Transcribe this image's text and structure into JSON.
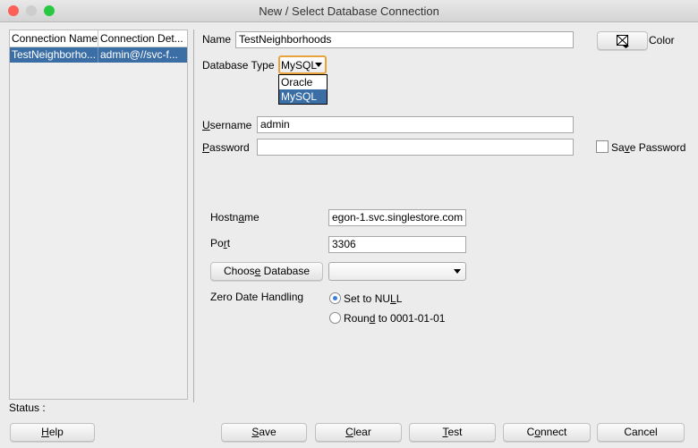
{
  "window": {
    "title": "New / Select Database Connection"
  },
  "connections": {
    "headers": [
      "Connection Name",
      "Connection Det..."
    ],
    "rows": [
      {
        "name": "TestNeighborho...",
        "details": "admin@//svc-f..."
      }
    ]
  },
  "form": {
    "name_label": "Name",
    "name_value": "TestNeighborhoods",
    "color_label": "Color",
    "dbtype_label": "Database Type",
    "dbtype_value": "MySQL",
    "dbtype_options": [
      "Oracle",
      "MySQL"
    ],
    "username_label": "Username",
    "username_mn": 0,
    "username_value": "admin",
    "password_label": "Password",
    "password_mn": 0,
    "password_value": "",
    "save_password_label": "Save Password",
    "save_password_mn": 2,
    "save_password_checked": false,
    "hostname_label": "Hostname",
    "hostname_mn": 5,
    "hostname_value": "egon-1.svc.singlestore.com",
    "port_label": "Port",
    "port_mn": 2,
    "port_value": "3306",
    "choose_db_label": "Choose Database",
    "choose_db_mn": 5,
    "database_value": "",
    "zero_date_label": "Zero Date Handling",
    "zero_date_options": [
      {
        "label": "Set to NULL",
        "mn": 9,
        "selected": true
      },
      {
        "label": "Round to 0001-01-01",
        "mn": 4,
        "selected": false
      }
    ]
  },
  "status": {
    "label": "Status :"
  },
  "buttons": {
    "help": {
      "label": "Help",
      "mn": 0
    },
    "save": {
      "label": "Save",
      "mn": 0
    },
    "clear": {
      "label": "Clear",
      "mn": 0
    },
    "test": {
      "label": "Test",
      "mn": 0
    },
    "connect": {
      "label": "Connect",
      "mn": 1
    },
    "cancel": {
      "label": "Cancel",
      "mn": -1
    }
  },
  "colors": {
    "selection": "#3a6ea5",
    "focus": "#e8a33c"
  }
}
